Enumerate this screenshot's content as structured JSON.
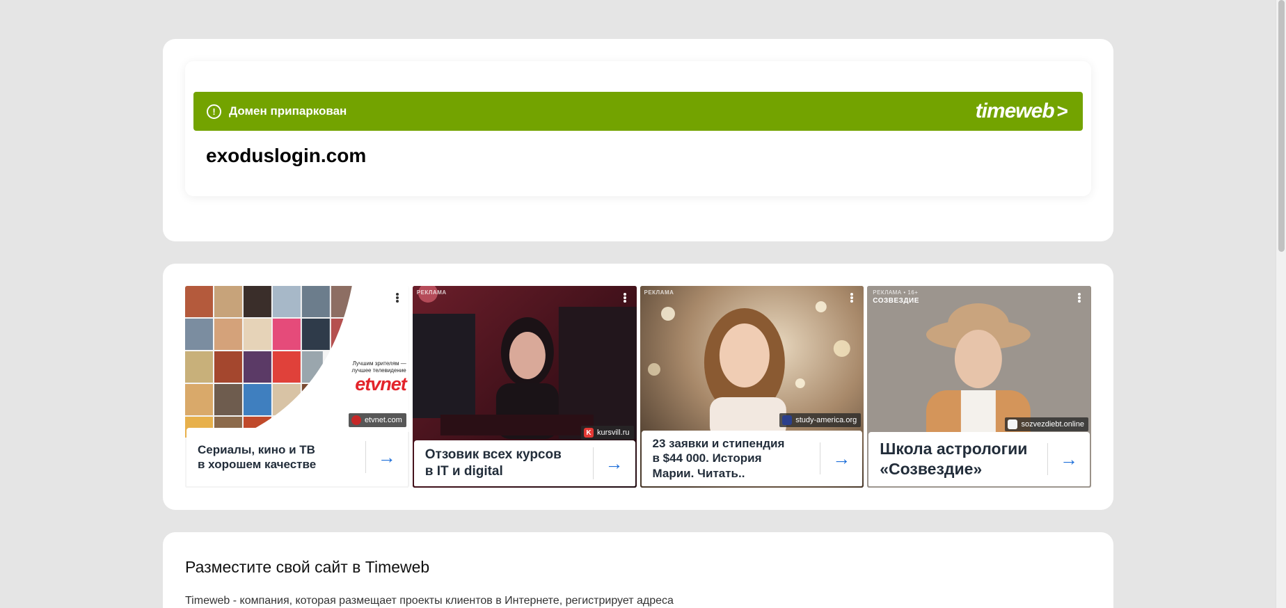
{
  "parked": {
    "banner_text": "Домен припаркован",
    "brand": "timeweb",
    "brand_chevron": ">",
    "info_symbol": "!",
    "domain": "exoduslogin.com",
    "accent_color": "#73a300"
  },
  "ads": [
    {
      "title_line1": "Сериалы, кино и ТВ",
      "title_line2": "в хорошем качестве",
      "source": "etvnet.com",
      "source_icon": "etvnet-icon",
      "overlay_tagline_1": "Лучшим зрителям —",
      "overlay_tagline_2": "лучшее телевидение",
      "overlay_logo": "etvnet"
    },
    {
      "ad_mark": "РЕКЛАМА",
      "title_line1": "Отзовик всех курсов",
      "title_line2": "в IT и digital",
      "source": "kursvill.ru",
      "source_icon_letter": "K"
    },
    {
      "ad_mark": "РЕКЛАМА",
      "title_line1": "23 заявки и стипендия",
      "title_line2": "в $44 000. История",
      "title_line3": "Марии. Читать..",
      "source": "study-america.org"
    },
    {
      "ad_mark": "РЕКЛАМА • 16+",
      "ad_brand": "СОЗВЕЗДИЕ",
      "title_line1": "Школа астрологии",
      "title_line2": "«Созвездие»",
      "source": "sozvezdiebt.online"
    }
  ],
  "ad_arrow": "→",
  "hosting": {
    "title": "Разместите свой сайт в Timeweb",
    "text": "Timeweb - компания, которая размещает проекты клиентов в Интернете, регистрирует адреса"
  }
}
